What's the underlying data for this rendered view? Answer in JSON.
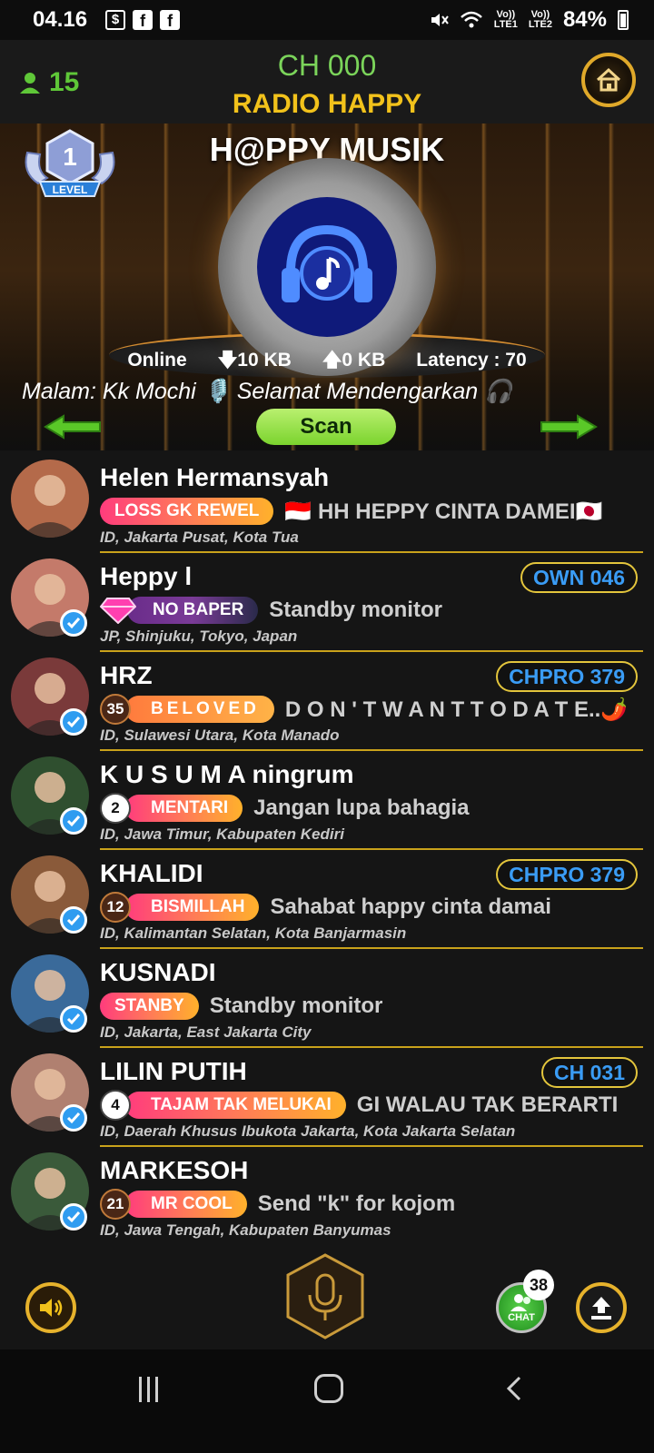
{
  "status_bar": {
    "time": "04.16",
    "battery": "84%",
    "network": [
      "LTE1",
      "LTE2"
    ],
    "icons": [
      "shopping-bag-icon",
      "facebook-icon",
      "facebook-icon",
      "mute-icon",
      "wifi-icon",
      "signal-icon",
      "battery-icon"
    ]
  },
  "header": {
    "user_count": "15",
    "channel": "CH 000",
    "radio_name": "RADIO HAPPY",
    "home_icon": "home-icon"
  },
  "stage": {
    "level_badge": "1",
    "level_label": "LEVEL",
    "title": "H@PPY MUSIK",
    "online_label": "Online",
    "download": "10 KB",
    "upload": "0 KB",
    "latency_label": "Latency : 70",
    "marquee": "Malam: Kk Mochi 🎙️ Selamat Mendengarkan 🎧",
    "scan_label": "Scan"
  },
  "users": [
    {
      "name": "Helen Hermansyah",
      "badge": "LOSS GK REWEL",
      "badge_style": "pink",
      "level": "",
      "status": "🇮🇩 HH HEPPY CINTA DAMEI🇯🇵",
      "location": "ID, Jakarta Pusat, Kota Tua",
      "tag": "",
      "verified": false,
      "avatar_color": "#b46a4a"
    },
    {
      "name": "Heppy l",
      "badge": "NO BAPER",
      "badge_style": "purple",
      "level": "",
      "status": "Standby monitor",
      "location": "JP, Shinjuku, Tokyo, Japan",
      "tag": "OWN 046",
      "verified": true,
      "avatar_color": "#c47a6a"
    },
    {
      "name": "HRZ",
      "badge": "BELOVED",
      "badge_style": "beloved",
      "level": "35",
      "status": "D O N ' T  W A N T  T O  D A T E..🌶️",
      "location": "ID, Sulawesi Utara, Kota Manado",
      "tag": "CHPRO 379",
      "verified": true,
      "avatar_color": "#7a3a3a"
    },
    {
      "name": "K U S U M A ningrum",
      "badge": "MENTARI",
      "badge_style": "pink",
      "level": "2",
      "status": "Jangan lupa bahagia",
      "location": "ID, Jawa Timur, Kabupaten Kediri",
      "tag": "",
      "verified": true,
      "avatar_color": "#2f4f2f"
    },
    {
      "name": "KHALIDI",
      "badge": "BISMILLAH",
      "badge_style": "pink",
      "level": "12",
      "status": "Sahabat happy cinta damai",
      "location": "ID, Kalimantan Selatan, Kota Banjarmasin",
      "tag": "CHPRO 379",
      "verified": true,
      "avatar_color": "#8a5a3a"
    },
    {
      "name": "KUSNADI",
      "badge": "STANBY",
      "badge_style": "pink",
      "level": "",
      "status": "Standby monitor",
      "location": "ID, Jakarta, East Jakarta City",
      "tag": "",
      "verified": true,
      "avatar_color": "#3a6a9a"
    },
    {
      "name": "LILIN PUTIH",
      "badge": "TAJAM TAK MELUKAI",
      "badge_style": "pink",
      "level": "4",
      "status": "GI WALAU TAK BERARTI",
      "location": "ID, Daerah Khusus Ibukota Jakarta, Kota Jakarta Selatan",
      "tag": "CH 031",
      "verified": true,
      "avatar_color": "#b08070"
    },
    {
      "name": "MARKESOH",
      "badge": "MR COOL",
      "badge_style": "pink",
      "level": "21",
      "status": "Send \"k\" for kojom",
      "location": "ID, Jawa Tengah, Kabupaten Banyumas",
      "tag": "",
      "verified": true,
      "avatar_color": "#3a5a3a"
    }
  ],
  "bottom": {
    "chat_label": "CHAT",
    "chat_count": "38",
    "icons": [
      "speaker-icon",
      "microphone-icon",
      "chat-icon",
      "upload-icon"
    ]
  },
  "colors": {
    "accent_gold": "#e6b22c",
    "accent_green": "#7bd45a",
    "tag_blue": "#3a9cf5"
  }
}
